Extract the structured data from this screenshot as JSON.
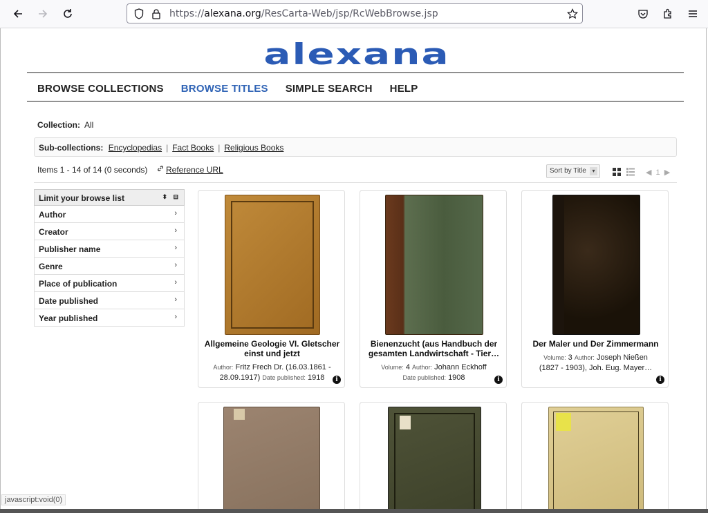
{
  "browser": {
    "url_prefix": "https://",
    "url_domain": "alexana.org",
    "url_path": "/ResCarta-Web/jsp/RcWebBrowse.jsp"
  },
  "logo_text": "alexana",
  "nav": [
    {
      "label": "BROWSE COLLECTIONS",
      "active": false
    },
    {
      "label": "BROWSE TITLES",
      "active": true
    },
    {
      "label": "SIMPLE SEARCH",
      "active": false
    },
    {
      "label": "HELP",
      "active": false
    }
  ],
  "collection": {
    "label": "Collection:",
    "value": "All"
  },
  "subcollections": {
    "label": "Sub-collections:",
    "links": [
      "Encyclopedias",
      "Fact Books",
      "Religious Books"
    ]
  },
  "results": {
    "summary": "Items 1 - 14 of 14 (0 seconds)",
    "reference_url": "Reference URL"
  },
  "sort": {
    "selected": "Sort by Title"
  },
  "pager": {
    "page": "1"
  },
  "sidebar": {
    "heading": "Limit your browse list",
    "items": [
      "Author",
      "Creator",
      "Publisher name",
      "Genre",
      "Place of publication",
      "Date published",
      "Year published"
    ]
  },
  "cards": [
    {
      "title": "Allgemeine Geologie VI. Gletscher einst und jetzt",
      "meta1": [
        [
          "Author:",
          "Fritz Frech Dr. (16.03.1861 -"
        ]
      ],
      "meta2": [
        [
          "",
          "28.09.1917)"
        ],
        [
          "Date published:",
          "1918"
        ]
      ]
    },
    {
      "title": "Bienenzucht (aus Handbuch der gesamten Landwirtschaft - Tier…",
      "meta1": [
        [
          "Volume:",
          "4"
        ],
        [
          "Author:",
          "Johann Eckhoff"
        ]
      ],
      "meta2": [
        [
          "Date published:",
          "1908"
        ]
      ]
    },
    {
      "title": "Der Maler und Der Zimmermann",
      "meta1": [
        [
          "Volume:",
          "3"
        ],
        [
          "Author:",
          "Joseph Nießen"
        ]
      ],
      "meta2": [
        [
          "",
          "(1827 - 1903), Joh. Eug. Mayer…"
        ]
      ]
    }
  ],
  "status_text": "javascript:void(0)",
  "colors": {
    "accent": "#2f63b5",
    "logo": "#2b5bb5"
  }
}
